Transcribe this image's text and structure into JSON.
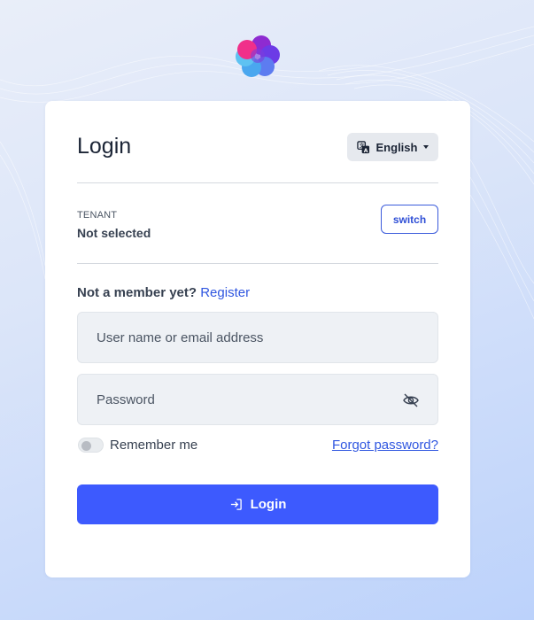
{
  "colors": {
    "primary": "#3d5afe",
    "link": "#2f56e0",
    "card_bg": "#ffffff",
    "field_bg": "#eef1f5",
    "background": "#c9dafa"
  },
  "logo": {
    "icon": "flower-logo-icon"
  },
  "login_card": {
    "title": "Login",
    "language": {
      "label": "English",
      "icon": "translate-icon"
    },
    "tenant": {
      "label": "TENANT",
      "value": "Not selected",
      "switch_label": "switch"
    },
    "register": {
      "prompt": "Not a member yet?",
      "link": "Register"
    },
    "username_field": {
      "placeholder": "User name or email address",
      "value": ""
    },
    "password_field": {
      "placeholder": "Password",
      "value": "",
      "icon": "eye-off-icon"
    },
    "remember_me": {
      "label": "Remember me",
      "checked": false
    },
    "forgot_password": "Forgot password?",
    "submit": {
      "label": "Login",
      "icon": "login-icon"
    }
  }
}
